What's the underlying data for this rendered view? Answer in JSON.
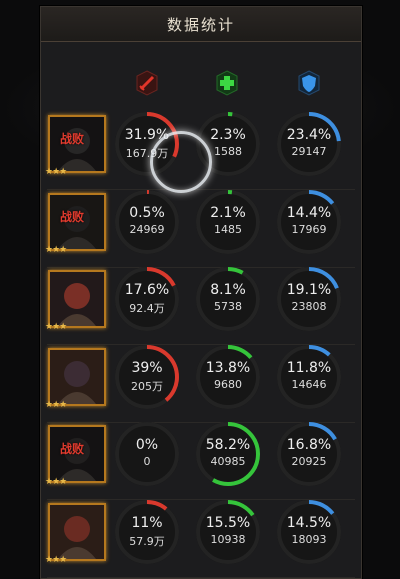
{
  "title": "数据统计",
  "header_icons": [
    {
      "name": "damage-icon",
      "color": "#d0302a"
    },
    {
      "name": "heal-icon",
      "color": "#35c83c"
    },
    {
      "name": "shield-icon",
      "color": "#3d8ee0"
    }
  ],
  "colors": {
    "damage": "#d9392d",
    "heal": "#35c43b",
    "tank": "#3e8fe0"
  },
  "rows": [
    {
      "defeated": true,
      "defeat_label": "战败",
      "stars": "★★★",
      "damage": {
        "pct": "31.9%",
        "value": "167.9万",
        "ratio": 0.319
      },
      "heal": {
        "pct": "2.3%",
        "value": "1588",
        "ratio": 0.023
      },
      "tank": {
        "pct": "23.4%",
        "value": "29147",
        "ratio": 0.234
      }
    },
    {
      "defeated": true,
      "defeat_label": "战败",
      "stars": "★★★",
      "damage": {
        "pct": "0.5%",
        "value": "24969",
        "ratio": 0.005
      },
      "heal": {
        "pct": "2.1%",
        "value": "1485",
        "ratio": 0.021
      },
      "tank": {
        "pct": "14.4%",
        "value": "17969",
        "ratio": 0.144
      }
    },
    {
      "defeated": false,
      "defeat_label": "",
      "stars": "★★★",
      "damage": {
        "pct": "17.6%",
        "value": "92.4万",
        "ratio": 0.176
      },
      "heal": {
        "pct": "8.1%",
        "value": "5738",
        "ratio": 0.081
      },
      "tank": {
        "pct": "19.1%",
        "value": "23808",
        "ratio": 0.191
      }
    },
    {
      "defeated": false,
      "defeat_label": "",
      "stars": "★★★",
      "damage": {
        "pct": "39%",
        "value": "205万",
        "ratio": 0.39
      },
      "heal": {
        "pct": "13.8%",
        "value": "9680",
        "ratio": 0.138
      },
      "tank": {
        "pct": "11.8%",
        "value": "14646",
        "ratio": 0.118
      }
    },
    {
      "defeated": true,
      "defeat_label": "战败",
      "stars": "★★★",
      "damage": {
        "pct": "0%",
        "value": "0",
        "ratio": 0
      },
      "heal": {
        "pct": "58.2%",
        "value": "40985",
        "ratio": 0.582
      },
      "tank": {
        "pct": "16.8%",
        "value": "20925",
        "ratio": 0.168
      }
    },
    {
      "defeated": false,
      "defeat_label": "",
      "stars": "★★★",
      "damage": {
        "pct": "11%",
        "value": "57.9万",
        "ratio": 0.11
      },
      "heal": {
        "pct": "15.5%",
        "value": "10938",
        "ratio": 0.155
      },
      "tank": {
        "pct": "14.5%",
        "value": "18093",
        "ratio": 0.145
      }
    }
  ]
}
